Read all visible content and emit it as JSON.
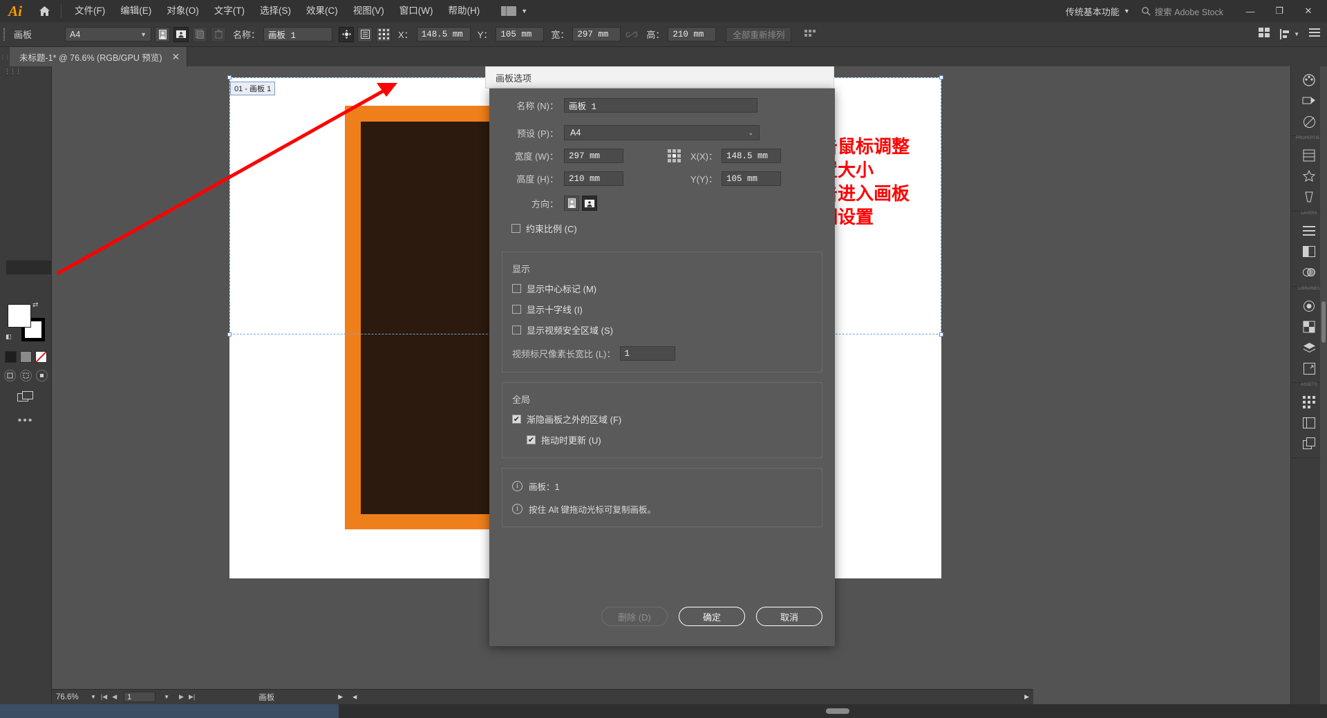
{
  "app": {
    "name": "Ai",
    "logo_text": "Ai"
  },
  "menubar": {
    "items": [
      {
        "label": "文件(F)"
      },
      {
        "label": "编辑(E)"
      },
      {
        "label": "对象(O)"
      },
      {
        "label": "文字(T)"
      },
      {
        "label": "选择(S)"
      },
      {
        "label": "效果(C)"
      },
      {
        "label": "视图(V)"
      },
      {
        "label": "窗口(W)"
      },
      {
        "label": "帮助(H)"
      }
    ],
    "workspace": "传统基本功能",
    "search_placeholder": "搜索 Adobe Stock",
    "window_buttons": {
      "minimize": "—",
      "maximize": "❐",
      "close": "✕"
    }
  },
  "controlbar": {
    "panel_label": "画板",
    "preset": "A4",
    "name_label": "名称：",
    "name_value": "画板 1",
    "x_label": "X：",
    "x_value": "148.5 mm",
    "y_label": "Y：",
    "y_value": "105 mm",
    "w_label": "宽：",
    "w_value": "297 mm",
    "h_label": "高：",
    "h_value": "210 mm",
    "rearrange_label": "全部重新排列"
  },
  "tab": {
    "title": "未标题-1* @ 76.6% (RGB/GPU 预览)",
    "close": "✕"
  },
  "canvas": {
    "artboard_label": "01 - 画板 1",
    "annotation_lines": [
      "单击鼠标调整",
      "设置大小",
      "双击进入画板",
      "详细设置"
    ],
    "annotation_color": "#ff0000",
    "art_orange": "#ef7f1a",
    "art_dark": "#2b1a0d"
  },
  "dialog": {
    "title": "画板选项",
    "name_label": "名称 (N)：",
    "name_value": "画板 1",
    "preset_label": "预设 (P)：",
    "preset_value": "A4",
    "width_label": "宽度 (W)：",
    "width_value": "297 mm",
    "height_label": "高度 (H)：",
    "height_value": "210 mm",
    "x_label": "X(X)：",
    "x_value": "148.5 mm",
    "y_label": "Y(Y)：",
    "y_value": "105 mm",
    "orientation_label": "方向：",
    "orientation_portrait": "纵向",
    "orientation_landscape": "横向",
    "constrain_label": "约束比例 (C)",
    "display_group": "显示",
    "center_mark_label": "显示中心标记 (M)",
    "crosshair_label": "显示十字线 (I)",
    "video_safe_label": "显示视频安全区域 (S)",
    "pixel_ratio_label": "视频标尺像素长宽比 (L)：",
    "pixel_ratio_value": "1",
    "global_group": "全局",
    "fade_label": "渐隐画板之外的区域 (F)",
    "update_drag_label": "拖动时更新 (U)",
    "info_artboard": "画板：1",
    "info_tip": "按住 Alt 键拖动光标可复制画板。",
    "delete_label": "删除 (D)",
    "ok_label": "确定",
    "cancel_label": "取消"
  },
  "statusbar": {
    "zoom": "76.6%",
    "page": "1",
    "mode": "画板"
  },
  "taskbar": {
    "time": ""
  }
}
